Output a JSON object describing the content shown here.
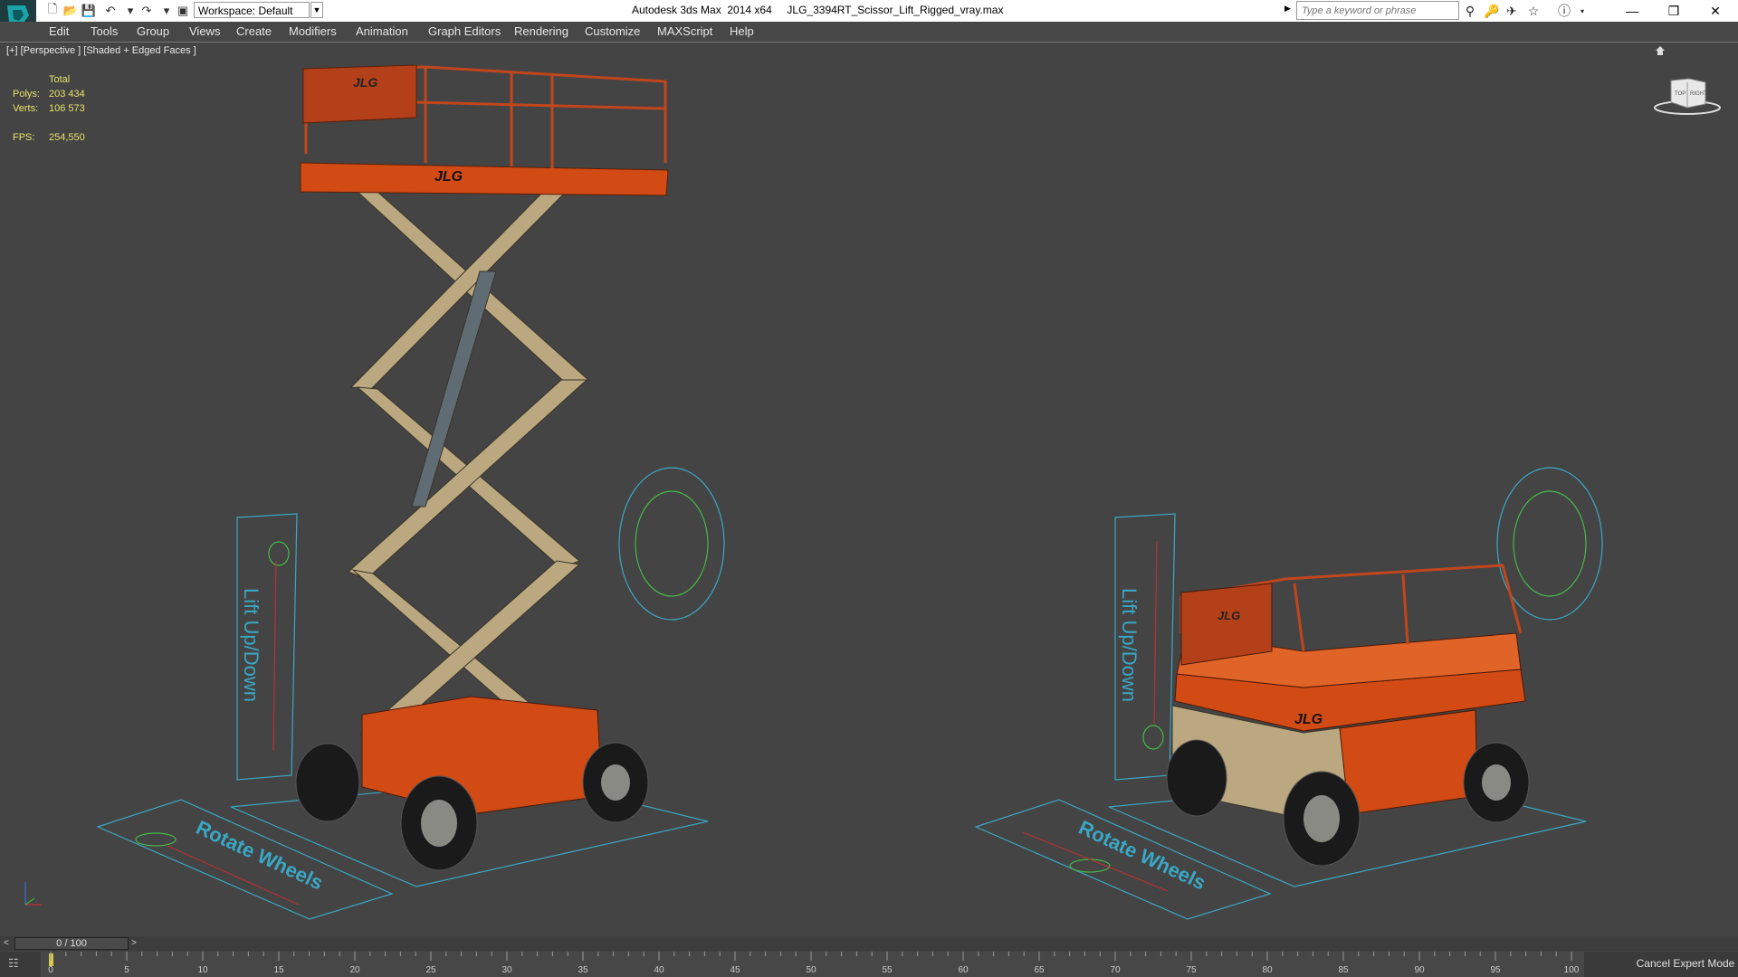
{
  "app": {
    "title": "Autodesk 3ds Max  2014 x64     JLG_3394RT_Scissor_Lift_Rigged_vray.max"
  },
  "toolbar": {
    "workspace": "Workspace: Default",
    "search_placeholder": "Type a keyword or phrase"
  },
  "menu": [
    {
      "label": "Edit"
    },
    {
      "label": "Tools"
    },
    {
      "label": "Group"
    },
    {
      "label": "Views"
    },
    {
      "label": "Create"
    },
    {
      "label": "Modifiers"
    },
    {
      "label": "Animation"
    },
    {
      "label": "Graph Editors"
    },
    {
      "label": "Rendering"
    },
    {
      "label": "Customize"
    },
    {
      "label": "MAXScript"
    },
    {
      "label": "Help"
    }
  ],
  "viewport": {
    "label": "[+] [Perspective ] [Shaded + Edged Faces ]",
    "stats": {
      "header": "Total",
      "polys_label": "Polys:",
      "polys": "203 434",
      "verts_label": "Verts:",
      "verts": "106 573",
      "fps_label": "FPS:",
      "fps": "254,550"
    },
    "helper_text_lift": "Lift Up/Down",
    "helper_text_rotate": "Rotate Wheels",
    "logo_text": "JLG"
  },
  "viewcube": {
    "left_face": "TOP",
    "right_face": "RIGHT"
  },
  "timeline": {
    "slider": "0 / 100",
    "prev": "<",
    "next": ">",
    "ticks": [
      "0",
      "5",
      "10",
      "15",
      "20",
      "25",
      "30",
      "35",
      "40",
      "45",
      "50",
      "55",
      "60",
      "65",
      "70",
      "75",
      "80",
      "85",
      "90",
      "95",
      "100"
    ]
  },
  "status": {
    "expert_mode": "Cancel Expert Mode"
  },
  "colors": {
    "viewport_bg": "#444444",
    "lift_orange": "#d24a14",
    "scissor_beige": "#bba880",
    "helper_blue": "#3aa7c4",
    "stats_yellow": "#e6e16a"
  }
}
